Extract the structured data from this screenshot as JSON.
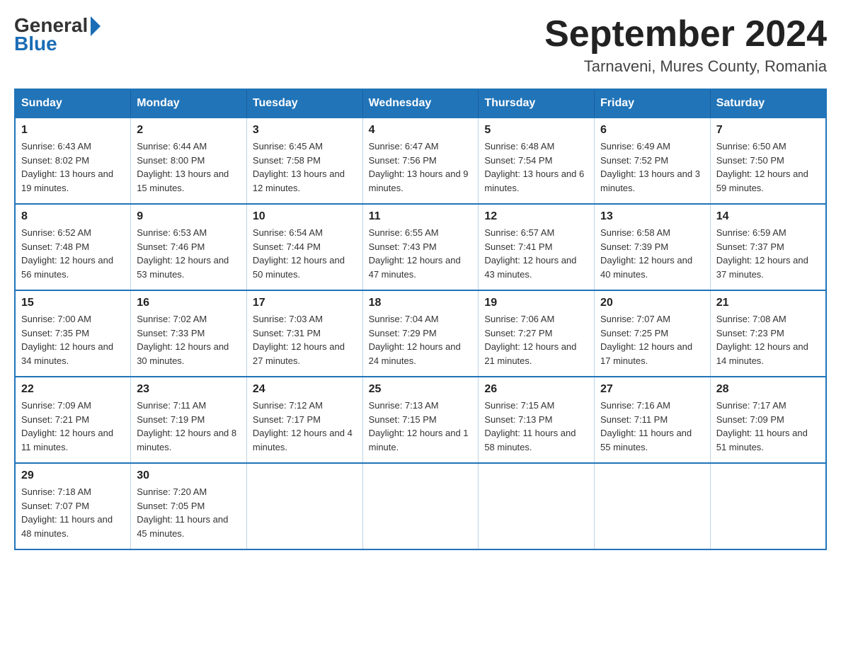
{
  "header": {
    "logo_general": "General",
    "logo_blue": "Blue",
    "month_year": "September 2024",
    "location": "Tarnaveni, Mures County, Romania"
  },
  "days_of_week": [
    "Sunday",
    "Monday",
    "Tuesday",
    "Wednesday",
    "Thursday",
    "Friday",
    "Saturday"
  ],
  "weeks": [
    [
      {
        "day": "1",
        "sunrise": "6:43 AM",
        "sunset": "8:02 PM",
        "daylight": "13 hours and 19 minutes."
      },
      {
        "day": "2",
        "sunrise": "6:44 AM",
        "sunset": "8:00 PM",
        "daylight": "13 hours and 15 minutes."
      },
      {
        "day": "3",
        "sunrise": "6:45 AM",
        "sunset": "7:58 PM",
        "daylight": "13 hours and 12 minutes."
      },
      {
        "day": "4",
        "sunrise": "6:47 AM",
        "sunset": "7:56 PM",
        "daylight": "13 hours and 9 minutes."
      },
      {
        "day": "5",
        "sunrise": "6:48 AM",
        "sunset": "7:54 PM",
        "daylight": "13 hours and 6 minutes."
      },
      {
        "day": "6",
        "sunrise": "6:49 AM",
        "sunset": "7:52 PM",
        "daylight": "13 hours and 3 minutes."
      },
      {
        "day": "7",
        "sunrise": "6:50 AM",
        "sunset": "7:50 PM",
        "daylight": "12 hours and 59 minutes."
      }
    ],
    [
      {
        "day": "8",
        "sunrise": "6:52 AM",
        "sunset": "7:48 PM",
        "daylight": "12 hours and 56 minutes."
      },
      {
        "day": "9",
        "sunrise": "6:53 AM",
        "sunset": "7:46 PM",
        "daylight": "12 hours and 53 minutes."
      },
      {
        "day": "10",
        "sunrise": "6:54 AM",
        "sunset": "7:44 PM",
        "daylight": "12 hours and 50 minutes."
      },
      {
        "day": "11",
        "sunrise": "6:55 AM",
        "sunset": "7:43 PM",
        "daylight": "12 hours and 47 minutes."
      },
      {
        "day": "12",
        "sunrise": "6:57 AM",
        "sunset": "7:41 PM",
        "daylight": "12 hours and 43 minutes."
      },
      {
        "day": "13",
        "sunrise": "6:58 AM",
        "sunset": "7:39 PM",
        "daylight": "12 hours and 40 minutes."
      },
      {
        "day": "14",
        "sunrise": "6:59 AM",
        "sunset": "7:37 PM",
        "daylight": "12 hours and 37 minutes."
      }
    ],
    [
      {
        "day": "15",
        "sunrise": "7:00 AM",
        "sunset": "7:35 PM",
        "daylight": "12 hours and 34 minutes."
      },
      {
        "day": "16",
        "sunrise": "7:02 AM",
        "sunset": "7:33 PM",
        "daylight": "12 hours and 30 minutes."
      },
      {
        "day": "17",
        "sunrise": "7:03 AM",
        "sunset": "7:31 PM",
        "daylight": "12 hours and 27 minutes."
      },
      {
        "day": "18",
        "sunrise": "7:04 AM",
        "sunset": "7:29 PM",
        "daylight": "12 hours and 24 minutes."
      },
      {
        "day": "19",
        "sunrise": "7:06 AM",
        "sunset": "7:27 PM",
        "daylight": "12 hours and 21 minutes."
      },
      {
        "day": "20",
        "sunrise": "7:07 AM",
        "sunset": "7:25 PM",
        "daylight": "12 hours and 17 minutes."
      },
      {
        "day": "21",
        "sunrise": "7:08 AM",
        "sunset": "7:23 PM",
        "daylight": "12 hours and 14 minutes."
      }
    ],
    [
      {
        "day": "22",
        "sunrise": "7:09 AM",
        "sunset": "7:21 PM",
        "daylight": "12 hours and 11 minutes."
      },
      {
        "day": "23",
        "sunrise": "7:11 AM",
        "sunset": "7:19 PM",
        "daylight": "12 hours and 8 minutes."
      },
      {
        "day": "24",
        "sunrise": "7:12 AM",
        "sunset": "7:17 PM",
        "daylight": "12 hours and 4 minutes."
      },
      {
        "day": "25",
        "sunrise": "7:13 AM",
        "sunset": "7:15 PM",
        "daylight": "12 hours and 1 minute."
      },
      {
        "day": "26",
        "sunrise": "7:15 AM",
        "sunset": "7:13 PM",
        "daylight": "11 hours and 58 minutes."
      },
      {
        "day": "27",
        "sunrise": "7:16 AM",
        "sunset": "7:11 PM",
        "daylight": "11 hours and 55 minutes."
      },
      {
        "day": "28",
        "sunrise": "7:17 AM",
        "sunset": "7:09 PM",
        "daylight": "11 hours and 51 minutes."
      }
    ],
    [
      {
        "day": "29",
        "sunrise": "7:18 AM",
        "sunset": "7:07 PM",
        "daylight": "11 hours and 48 minutes."
      },
      {
        "day": "30",
        "sunrise": "7:20 AM",
        "sunset": "7:05 PM",
        "daylight": "11 hours and 45 minutes."
      },
      null,
      null,
      null,
      null,
      null
    ]
  ],
  "labels": {
    "sunrise": "Sunrise:",
    "sunset": "Sunset:",
    "daylight": "Daylight:"
  }
}
